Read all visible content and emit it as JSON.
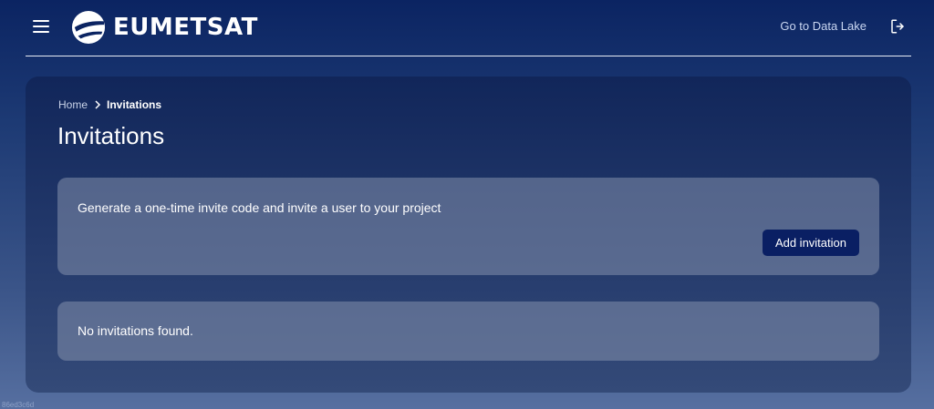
{
  "header": {
    "brand": "EUMETSAT",
    "datalake_link": "Go to Data Lake"
  },
  "icons": {
    "menu": "hamburger-menu-icon",
    "logo": "eumetsat-logo-icon",
    "logout": "logout-icon",
    "breadcrumb_separator": "chevron-right-icon"
  },
  "breadcrumb": {
    "home": "Home",
    "current": "Invitations"
  },
  "page": {
    "title": "Invitations"
  },
  "invite_card": {
    "description": "Generate a one-time invite code and invite a user to your project",
    "button_label": "Add invitation"
  },
  "empty_card": {
    "message": "No invitations found."
  },
  "footer": {
    "version": "86ed3c6d"
  },
  "colors": {
    "button_bg": "#0a1f63",
    "link": "#c9d6f1"
  }
}
